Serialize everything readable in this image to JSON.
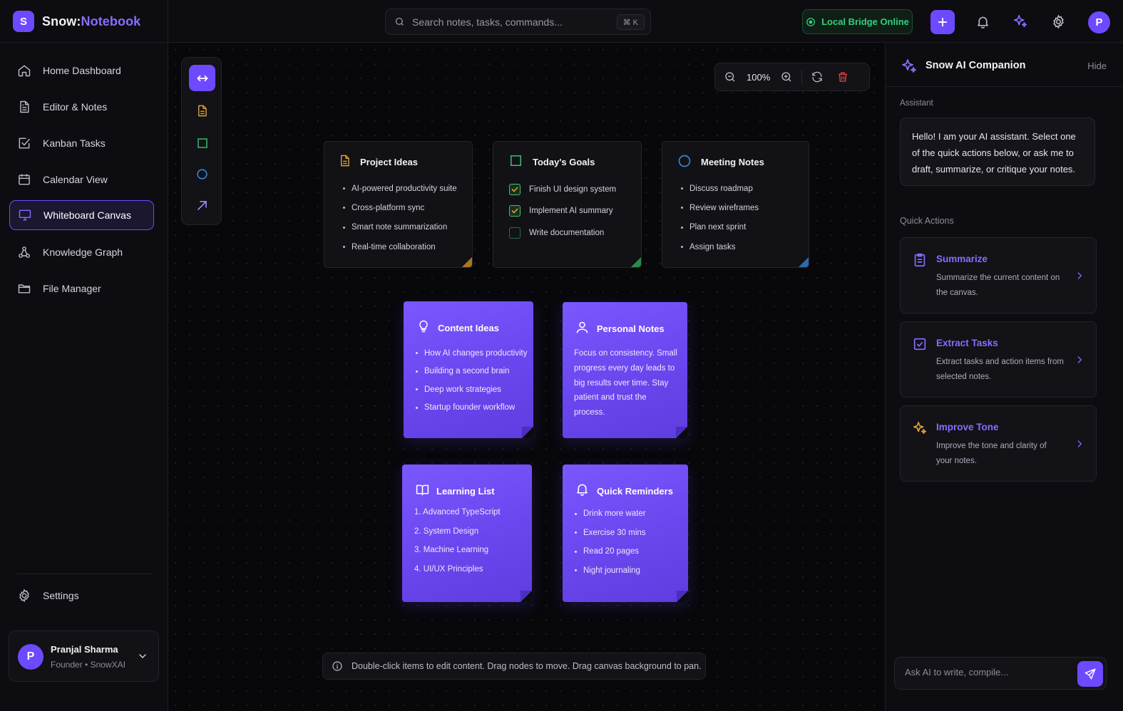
{
  "brand": {
    "logo_letter": "S",
    "name_prefix": "Snow:",
    "name_suffix": "Notebook",
    "accent": "#8b6cff"
  },
  "header": {
    "search_placeholder": "Search notes, tasks, commands...",
    "shortcut": "⌘ K",
    "bridge_status": "Local Bridge Online",
    "avatar_letter": "P"
  },
  "sidebar": {
    "items": [
      {
        "label": "Home Dashboard",
        "icon": "home-icon"
      },
      {
        "label": "Editor & Notes",
        "icon": "document-icon"
      },
      {
        "label": "Kanban Tasks",
        "icon": "checkbox-icon"
      },
      {
        "label": "Calendar View",
        "icon": "calendar-icon"
      },
      {
        "label": "Whiteboard Canvas",
        "icon": "monitor-icon",
        "active": true
      },
      {
        "label": "Knowledge Graph",
        "icon": "graph-icon"
      },
      {
        "label": "File Manager",
        "icon": "folder-icon"
      }
    ],
    "settings_label": "Settings",
    "user": {
      "initial": "P",
      "name": "Pranjal Sharma",
      "role": "Founder • SnowXAI"
    }
  },
  "canvas": {
    "zoom": "100%",
    "hint": "Double-click items to edit content. Drag nodes to move. Drag canvas background to pan.",
    "cards": {
      "project_ideas": {
        "title": "Project Ideas",
        "items": [
          "AI-powered productivity suite",
          "Cross-platform sync",
          "Smart note summarization",
          "Real-time collaboration"
        ],
        "accent": "#e0a030"
      },
      "todays_goals": {
        "title": "Today's Goals",
        "items": [
          {
            "label": "Finish UI design system",
            "checked": true
          },
          {
            "label": "Implement AI summary",
            "checked": true
          },
          {
            "label": "Write documentation",
            "checked": false
          }
        ],
        "accent": "#3bb86a"
      },
      "meeting_notes": {
        "title": "Meeting Notes",
        "items": [
          "Discuss roadmap",
          "Review wireframes",
          "Plan next sprint",
          "Assign tasks"
        ],
        "accent": "#3a86d8"
      },
      "content_ideas": {
        "title": "Content Ideas",
        "items": [
          "How AI changes productivity",
          "Building a second brain",
          "Deep work strategies",
          "Startup founder workflow"
        ]
      },
      "personal_notes": {
        "title": "Personal Notes",
        "text": "Focus on consistency. Small progress every day leads to big results over time. Stay patient and trust the process."
      },
      "learning_list": {
        "title": "Learning List",
        "items": [
          "1. Advanced TypeScript",
          "2. System Design",
          "3. Machine Learning",
          "4. UI/UX Principles"
        ]
      },
      "quick_reminders": {
        "title": "Quick Reminders",
        "items": [
          "Drink more water",
          "Exercise 30 mins",
          "Read 20 pages",
          "Night journaling"
        ]
      }
    }
  },
  "ai_panel": {
    "title": "Snow AI Companion",
    "hide_label": "Hide",
    "assistant_label": "Assistant",
    "assistant_message": "Hello! I am your AI assistant. Select one of the quick actions below, or ask me to draft, summarize, or critique your notes.",
    "quick_actions_label": "Quick Actions",
    "actions": [
      {
        "title": "Summarize",
        "desc": "Summarize the current content on the canvas.",
        "color": "#8b6cff"
      },
      {
        "title": "Extract Tasks",
        "desc": "Extract tasks and action items from selected notes.",
        "color": "#8b6cff"
      },
      {
        "title": "Improve Tone",
        "desc": "Improve the tone and clarity of your notes.",
        "color": "#8b6cff"
      }
    ],
    "input_placeholder": "Ask AI to write, compile..."
  }
}
